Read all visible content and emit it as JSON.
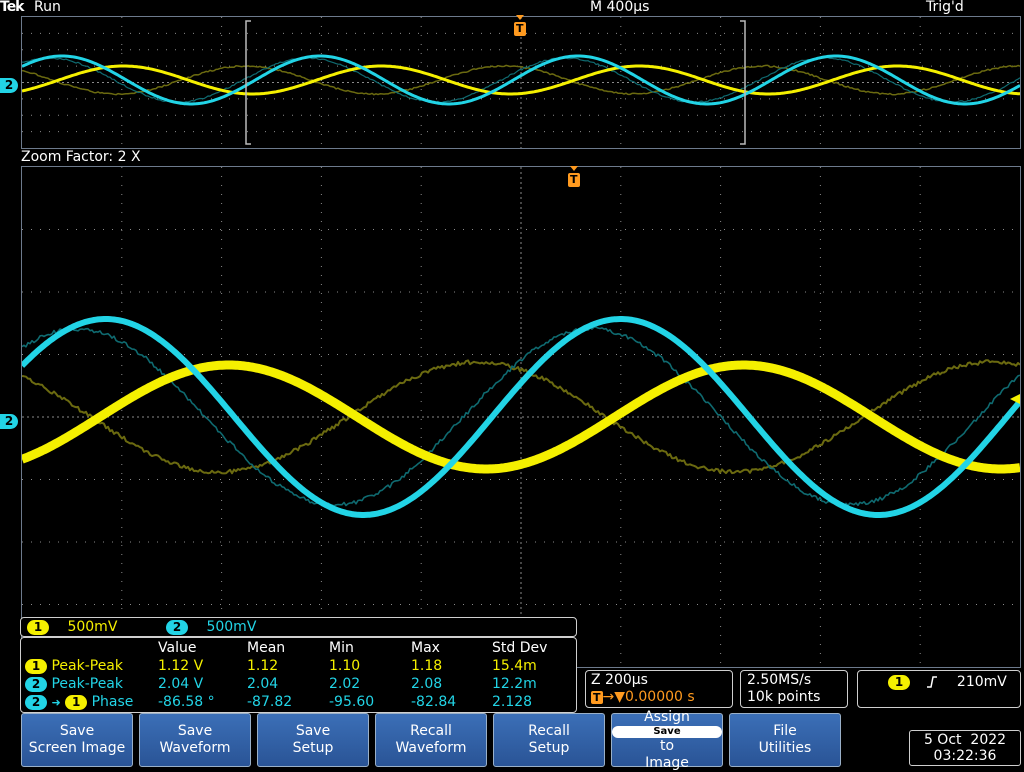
{
  "status": {
    "logo": "Tek",
    "run_state": "Run",
    "timebase": "M 400µs",
    "trigger_state": "Trig'd"
  },
  "overview": {
    "channel_marker": "2",
    "trigger_marker": "T"
  },
  "zoom": {
    "label": "Zoom Factor: 2 X",
    "channel_marker": "2",
    "trigger_marker": "T"
  },
  "channel_scales": [
    {
      "badge": "1",
      "scale": "500mV"
    },
    {
      "badge": "2",
      "scale": "500mV"
    }
  ],
  "measurements": {
    "headers": [
      "Value",
      "Mean",
      "Min",
      "Max",
      "Std Dev"
    ],
    "rows": [
      {
        "badge": "1",
        "name": "Peak-Peak",
        "value": "1.12 V",
        "mean": "1.12",
        "min": "1.10",
        "max": "1.18",
        "std": "15.4m"
      },
      {
        "badge": "2",
        "name": "Peak-Peak",
        "value": "2.04 V",
        "mean": "2.04",
        "min": "2.02",
        "max": "2.08",
        "std": "12.2m"
      },
      {
        "badge": "2",
        "badge2": "1",
        "name": "Phase",
        "value": "-86.58 °",
        "mean": "-87.82",
        "min": "-95.60",
        "max": "-82.84",
        "std": "2.128"
      }
    ]
  },
  "zoom_panel": {
    "scale": "Z 200µs",
    "trigger_pos": "0.00000 s"
  },
  "acquisition": {
    "sample_rate": "2.50MS/s",
    "record_length": "10k points"
  },
  "trigger": {
    "source": "1",
    "level": "210mV"
  },
  "softkeys": [
    {
      "line1": "Save",
      "line2": "Screen Image"
    },
    {
      "line1": "Save",
      "line2": "Waveform"
    },
    {
      "line1": "Save",
      "line2": "Setup"
    },
    {
      "line1": "Recall",
      "line2": "Waveform"
    },
    {
      "line1": "Recall",
      "line2": "Setup"
    },
    {
      "line1": "Assign",
      "pill": "Save",
      "mid": "to",
      "line2": "Image"
    },
    {
      "line1": "File",
      "line2": "Utilities"
    }
  ],
  "datetime": {
    "date": "5 Oct  2022",
    "time": "03:22:36"
  },
  "colors": {
    "ch1": "#f5f000",
    "ch2": "#22d4e6",
    "ref_yellow": "#6b6a10",
    "ref_cyan": "#0f6a70",
    "trigger": "#ff9a1f",
    "grid": "#8a8a8a"
  }
}
